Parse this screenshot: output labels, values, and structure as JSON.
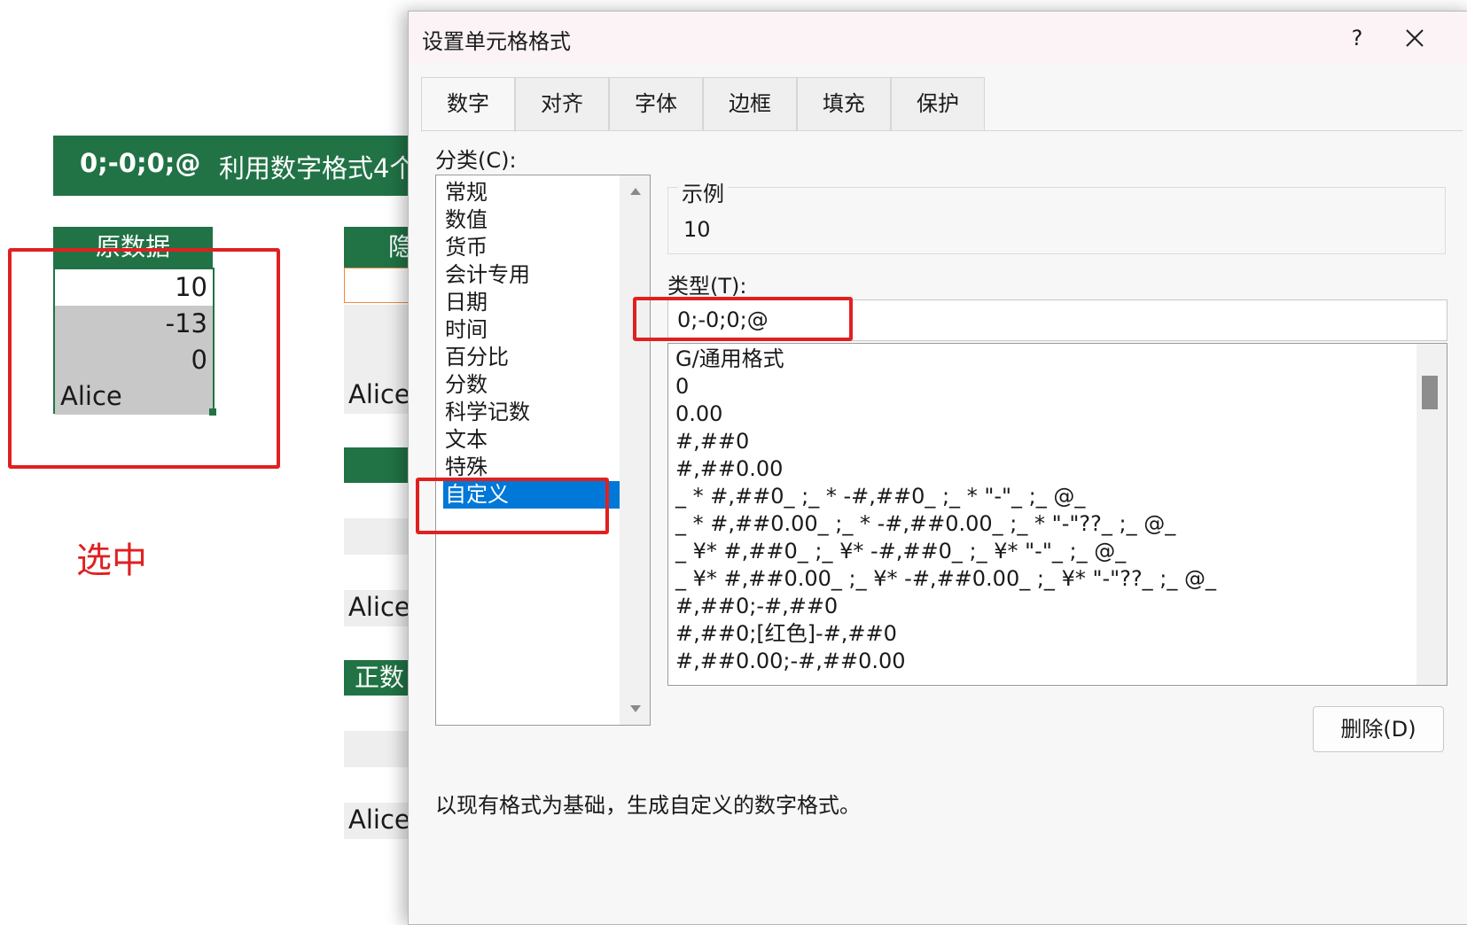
{
  "sheet": {
    "banner_format": "0;-0;0;@",
    "banner_desc": "利用数字格式4个",
    "orig_header": "原数据",
    "orig_values": [
      "10",
      "-13",
      "0",
      "Alice"
    ],
    "right_header_1": "隐",
    "right_header_2": "",
    "right_header_3": "正数",
    "alice": "Alice",
    "note": "选中"
  },
  "dialog": {
    "title": "设置单元格格式",
    "help": "?",
    "tabs": [
      "数字",
      "对齐",
      "字体",
      "边框",
      "填充",
      "保护"
    ],
    "category_label": "分类(C):",
    "category_label_key": "C",
    "categories": [
      "常规",
      "数值",
      "货币",
      "会计专用",
      "日期",
      "时间",
      "百分比",
      "分数",
      "科学记数",
      "文本",
      "特殊",
      "自定义"
    ],
    "selected_category": "自定义",
    "sample_label": "示例",
    "sample_value": "10",
    "type_label": "类型(T):",
    "type_value": "0;-0;0;@",
    "formats": [
      "G/通用格式",
      "0",
      "0.00",
      "#,##0",
      "#,##0.00",
      "_ * #,##0_ ;_ * -#,##0_ ;_ * \"-\"_ ;_ @_",
      "_ * #,##0.00_ ;_ * -#,##0.00_ ;_ * \"-\"??_ ;_ @_",
      "_ ¥* #,##0_ ;_ ¥* -#,##0_ ;_ ¥* \"-\"_ ;_ @_",
      "_ ¥* #,##0.00_ ;_ ¥* -#,##0.00_ ;_ ¥* \"-\"??_ ;_ @_",
      "#,##0;-#,##0",
      "#,##0;[红色]-#,##0",
      "#,##0.00;-#,##0.00"
    ],
    "delete_label": "删除(D)",
    "hint": "以现有格式为基础，生成自定义的数字格式。"
  },
  "colors": {
    "excel_green": "#217346",
    "highlight_red": "#e02020",
    "selection_blue": "#0078d7"
  }
}
